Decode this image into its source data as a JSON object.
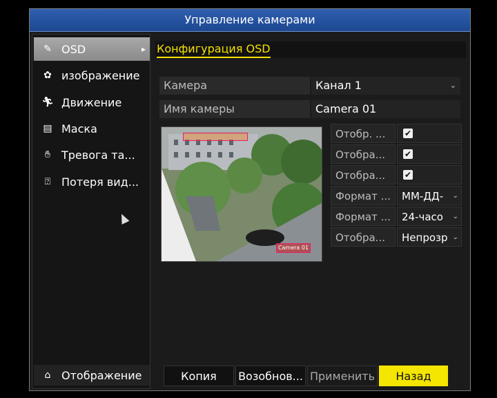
{
  "window": {
    "title": "Управление камерами"
  },
  "sidebar": {
    "items": [
      {
        "label": "OSD",
        "icon": "edit-icon",
        "active": true
      },
      {
        "label": "изображение",
        "icon": "image-adjust-icon",
        "active": false
      },
      {
        "label": "Движение",
        "icon": "running-person-icon",
        "active": false
      },
      {
        "label": "Маска",
        "icon": "mask-icon",
        "active": false
      },
      {
        "label": "Тревога та...",
        "icon": "hand-icon",
        "active": false
      },
      {
        "label": "Потеря вид...",
        "icon": "video-loss-icon",
        "active": false
      }
    ],
    "bottom": {
      "label": "Отображение",
      "icon": "home-icon"
    }
  },
  "main": {
    "section_title": "Конфигурация OSD",
    "camera": {
      "label": "Камера",
      "value": "Канал 1"
    },
    "camera_name": {
      "label": "Имя камеры",
      "value": "Camera 01"
    },
    "preview_overlay_text": "Camera 01",
    "options": [
      {
        "label": "Отобр. ...",
        "type": "checkbox",
        "checked": true
      },
      {
        "label": "Отобра...",
        "type": "checkbox",
        "checked": true
      },
      {
        "label": "Отобра...",
        "type": "checkbox",
        "checked": true
      },
      {
        "label": "Формат ...",
        "type": "select",
        "value": "ММ-ДД-"
      },
      {
        "label": "Формат ...",
        "type": "select",
        "value": "24-часо"
      },
      {
        "label": "Отобра...",
        "type": "select",
        "value": "Непрозр"
      }
    ],
    "buttons": [
      {
        "label": "Копия",
        "style": "normal"
      },
      {
        "label": "Возобнов...",
        "style": "normal"
      },
      {
        "label": "Применить",
        "style": "dim"
      },
      {
        "label": "Назад",
        "style": "primary"
      }
    ]
  },
  "colors": {
    "accent": "#f5e100",
    "titlebar": "#2f5fae"
  }
}
